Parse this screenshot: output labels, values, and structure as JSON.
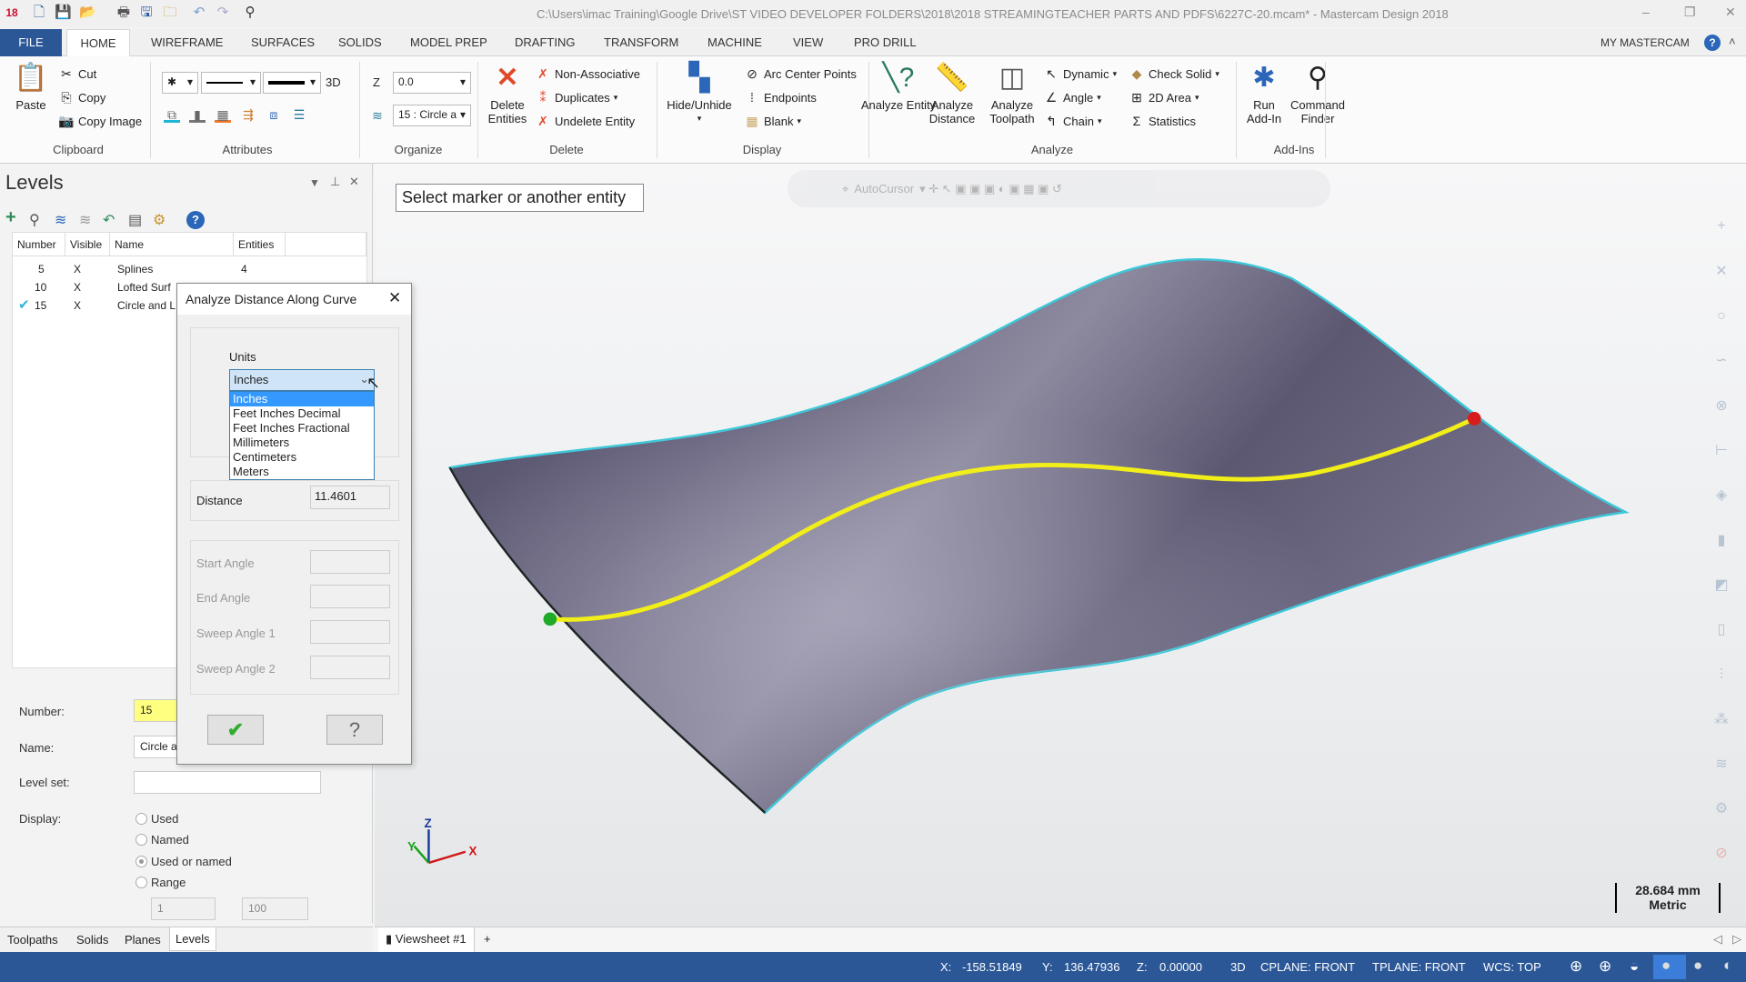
{
  "window": {
    "title": "C:\\Users\\imac Training\\Google Drive\\ST VIDEO DEVELOPER FOLDERS\\2018\\2018 STREAMINGTEACHER PARTS AND PDFS\\6227C-20.mcam* - Mastercam Design 2018",
    "app_badge": "18"
  },
  "tabs": [
    "FILE",
    "HOME",
    "WIREFRAME",
    "SURFACES",
    "SOLIDS",
    "MODEL PREP",
    "DRAFTING",
    "TRANSFORM",
    "MACHINE",
    "VIEW",
    "PRO DRILL"
  ],
  "account": "MY MASTERCAM",
  "ribbon": {
    "clipboard": {
      "label": "Clipboard",
      "paste": "Paste",
      "cut": "Cut",
      "copy": "Copy",
      "copy_image": "Copy Image"
    },
    "attributes": {
      "label": "Attributes",
      "mode": "3D"
    },
    "organize": {
      "label": "Organize",
      "z_label": "Z",
      "z_value": "0.0",
      "level_value": "15 : Circle a"
    },
    "delete": {
      "label": "Delete",
      "delete_entities": "Delete Entities",
      "non_associative": "Non-Associative",
      "duplicates": "Duplicates",
      "undelete_entity": "Undelete Entity"
    },
    "display": {
      "label": "Display",
      "hide_unhide": "Hide/Unhide",
      "arc_center_points": "Arc Center Points",
      "endpoints": "Endpoints",
      "blank": "Blank"
    },
    "analyze": {
      "label": "Analyze",
      "analyze_entity": "Analyze Entity",
      "analyze_distance": "Analyze Distance",
      "analyze_toolpath": "Analyze Toolpath",
      "dynamic": "Dynamic",
      "angle": "Angle",
      "chain": "Chain",
      "check_solid": "Check Solid",
      "area_2d": "2D Area",
      "statistics": "Statistics"
    },
    "addins": {
      "label": "Add-Ins",
      "run_addin": "Run Add-In",
      "command_finder": "Command Finder"
    }
  },
  "levels": {
    "title": "Levels",
    "columns": [
      "Number",
      "Visible",
      "Name",
      "Entities"
    ],
    "rows": [
      {
        "number": "5",
        "visible": "X",
        "name": "Splines",
        "entities": "4",
        "active": false
      },
      {
        "number": "10",
        "visible": "X",
        "name": "Lofted Surf",
        "entities": "",
        "active": false
      },
      {
        "number": "15",
        "visible": "X",
        "name": "Circle and L",
        "entities": "",
        "active": true
      }
    ],
    "form": {
      "number_label": "Number:",
      "number_value": "15",
      "name_label": "Name:",
      "name_value": "Circle a",
      "levelset_label": "Level set:",
      "levelset_value": "",
      "display_label": "Display:",
      "display_options": [
        "Used",
        "Named",
        "Used or named",
        "Range"
      ],
      "display_selected": "Used or named",
      "range_from": "1",
      "range_to": "100"
    },
    "bottom_tabs": [
      "Toolpaths",
      "Solids",
      "Planes",
      "Levels"
    ],
    "active_tab": "Levels"
  },
  "dialog": {
    "title": "Analyze Distance Along Curve",
    "units_label": "Units",
    "units_value": "Inches",
    "units_options": [
      "Inches",
      "Feet Inches Decimal",
      "Feet Inches Fractional",
      "Millimeters",
      "Centimeters",
      "Meters"
    ],
    "distance_label": "Distance",
    "distance_value": "11.4601",
    "start_angle_label": "Start Angle",
    "end_angle_label": "End Angle",
    "sweep1_label": "Sweep Angle 1",
    "sweep2_label": "Sweep Angle 2"
  },
  "viewport": {
    "prompt": "Select marker or another entity",
    "autocursor": "AutoCursor",
    "scale_value": "28.684 mm",
    "scale_unit": "Metric",
    "axis": {
      "z": "Z",
      "x": "X",
      "y": "Y"
    },
    "viewsheet_tab": "Viewsheet #1",
    "add_tab": "+",
    "colors": {
      "surface": "#5f5c72",
      "edge": "#3cc8d8",
      "curve": "#f2ee1a",
      "start_marker": "#1faa2a",
      "end_marker": "#d81b1b"
    }
  },
  "status": {
    "x_label": "X:",
    "x": "-158.51849",
    "y_label": "Y:",
    "y": "136.47936",
    "z_label": "Z:",
    "z": "0.00000",
    "mode": "3D",
    "cplane": "CPLANE: FRONT",
    "tplane": "TPLANE: FRONT",
    "wcs": "WCS: TOP"
  }
}
